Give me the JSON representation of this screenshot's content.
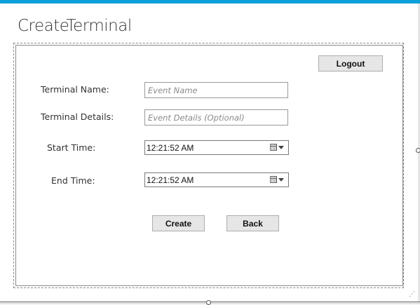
{
  "header": {
    "title": "CreateTerminal"
  },
  "toolbar": {
    "logout_label": "Logout"
  },
  "form": {
    "terminal_name": {
      "label": "Terminal Name:",
      "placeholder": "Event Name",
      "value": ""
    },
    "terminal_details": {
      "label": "Terminal Details:",
      "placeholder": "Event Details (Optional)",
      "value": ""
    },
    "start_time": {
      "label": "Start Time:",
      "value": "12:21:52 AM",
      "icon": "calendar-icon"
    },
    "end_time": {
      "label": "End Time:",
      "value": "12:21:52 AM",
      "icon": "calendar-icon"
    }
  },
  "actions": {
    "create_label": "Create",
    "back_label": "Back"
  },
  "colors": {
    "accent": "#0aa0d8",
    "button_bg": "#e6e6e6"
  }
}
